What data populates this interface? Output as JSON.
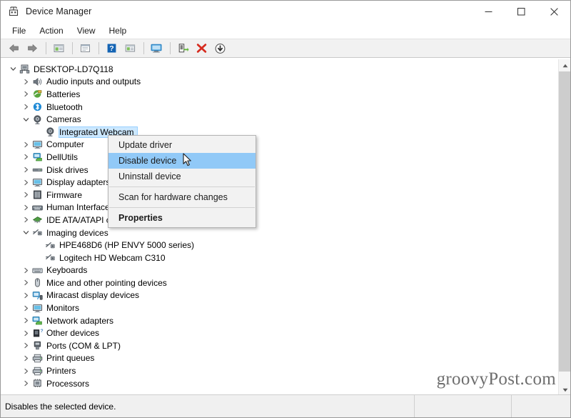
{
  "window": {
    "title": "Device Manager",
    "icon": "device-manager-icon",
    "controls": {
      "minimize": "—",
      "maximize": "☐",
      "close": "✕"
    }
  },
  "menubar": {
    "items": [
      {
        "label": "File"
      },
      {
        "label": "Action"
      },
      {
        "label": "View"
      },
      {
        "label": "Help"
      }
    ]
  },
  "toolbar": {
    "buttons": [
      {
        "name": "back-icon",
        "title": "Back"
      },
      {
        "name": "forward-icon",
        "title": "Forward"
      },
      {
        "name": "show-hide-console-tree-icon",
        "title": "Show/Hide Console Tree"
      },
      {
        "name": "properties-icon",
        "title": "Properties"
      },
      {
        "name": "help-icon",
        "title": "Help"
      },
      {
        "name": "update-driver-icon",
        "title": "Update driver"
      },
      {
        "name": "scan-hardware-changes-icon",
        "title": "Scan for hardware changes"
      },
      {
        "name": "enable-device-icon",
        "title": "Enable device"
      },
      {
        "name": "uninstall-device-icon",
        "title": "Uninstall device"
      },
      {
        "name": "disable-device-icon",
        "title": "Disable device"
      }
    ]
  },
  "tree": {
    "rows": [
      {
        "label": "DESKTOP-LD7Q118",
        "indent": 0,
        "expander": "expanded",
        "icon": "computer-icon",
        "selected": false
      },
      {
        "label": "Audio inputs and outputs",
        "indent": 1,
        "expander": "collapsed",
        "icon": "audio-icon",
        "selected": false
      },
      {
        "label": "Batteries",
        "indent": 1,
        "expander": "collapsed",
        "icon": "battery-icon",
        "selected": false
      },
      {
        "label": "Bluetooth",
        "indent": 1,
        "expander": "collapsed",
        "icon": "bluetooth-icon",
        "selected": false
      },
      {
        "label": "Cameras",
        "indent": 1,
        "expander": "expanded",
        "icon": "camera-icon",
        "selected": false
      },
      {
        "label": "Integrated Webcam",
        "indent": 2,
        "expander": "none",
        "icon": "camera-icon",
        "selected": true
      },
      {
        "label": "Computer",
        "indent": 1,
        "expander": "collapsed",
        "icon": "monitor-icon",
        "selected": false
      },
      {
        "label": "DellUtils",
        "indent": 1,
        "expander": "collapsed",
        "icon": "dellutils-icon",
        "selected": false
      },
      {
        "label": "Disk drives",
        "indent": 1,
        "expander": "collapsed",
        "icon": "disk-drive-icon",
        "selected": false
      },
      {
        "label": "Display adapters",
        "indent": 1,
        "expander": "collapsed",
        "icon": "display-adapter-icon",
        "selected": false
      },
      {
        "label": "Firmware",
        "indent": 1,
        "expander": "collapsed",
        "icon": "firmware-icon",
        "selected": false
      },
      {
        "label": "Human Interface Devices",
        "indent": 1,
        "expander": "collapsed",
        "icon": "hid-icon",
        "selected": false
      },
      {
        "label": "IDE ATA/ATAPI controllers",
        "indent": 1,
        "expander": "collapsed",
        "icon": "ide-controller-icon",
        "selected": false
      },
      {
        "label": "Imaging devices",
        "indent": 1,
        "expander": "expanded",
        "icon": "imaging-device-icon",
        "selected": false
      },
      {
        "label": "HPE468D6 (HP ENVY 5000 series)",
        "indent": 2,
        "expander": "none",
        "icon": "imaging-device-icon",
        "selected": false
      },
      {
        "label": "Logitech HD Webcam C310",
        "indent": 2,
        "expander": "none",
        "icon": "imaging-device-icon",
        "selected": false
      },
      {
        "label": "Keyboards",
        "indent": 1,
        "expander": "collapsed",
        "icon": "keyboard-icon",
        "selected": false
      },
      {
        "label": "Mice and other pointing devices",
        "indent": 1,
        "expander": "collapsed",
        "icon": "mouse-icon",
        "selected": false
      },
      {
        "label": "Miracast display devices",
        "indent": 1,
        "expander": "collapsed",
        "icon": "miracast-icon",
        "selected": false
      },
      {
        "label": "Monitors",
        "indent": 1,
        "expander": "collapsed",
        "icon": "monitor-icon",
        "selected": false
      },
      {
        "label": "Network adapters",
        "indent": 1,
        "expander": "collapsed",
        "icon": "network-adapter-icon",
        "selected": false
      },
      {
        "label": "Other devices",
        "indent": 1,
        "expander": "collapsed",
        "icon": "other-device-icon",
        "selected": false
      },
      {
        "label": "Ports (COM & LPT)",
        "indent": 1,
        "expander": "collapsed",
        "icon": "port-icon",
        "selected": false
      },
      {
        "label": "Print queues",
        "indent": 1,
        "expander": "collapsed",
        "icon": "printer-icon",
        "selected": false
      },
      {
        "label": "Printers",
        "indent": 1,
        "expander": "collapsed",
        "icon": "printer-icon",
        "selected": false
      },
      {
        "label": "Processors",
        "indent": 1,
        "expander": "collapsed",
        "icon": "processor-icon",
        "selected": false
      }
    ]
  },
  "context_menu": {
    "items": [
      {
        "label": "Update driver",
        "type": "item",
        "highlighted": false,
        "bold": false
      },
      {
        "label": "Disable device",
        "type": "item",
        "highlighted": true,
        "bold": false
      },
      {
        "label": "Uninstall device",
        "type": "item",
        "highlighted": false,
        "bold": false
      },
      {
        "label": "",
        "type": "separator",
        "highlighted": false,
        "bold": false
      },
      {
        "label": "Scan for hardware changes",
        "type": "item",
        "highlighted": false,
        "bold": false
      },
      {
        "label": "",
        "type": "separator",
        "highlighted": false,
        "bold": false
      },
      {
        "label": "Properties",
        "type": "item",
        "highlighted": false,
        "bold": true
      }
    ]
  },
  "statusbar": {
    "message": "Disables the selected device."
  },
  "watermark": {
    "text": "groovyPost.com"
  },
  "scrollbar": {
    "up_arrow": "▲",
    "down_arrow": "▼"
  },
  "colors": {
    "selection_blue": "#cce8ff",
    "menu_highlight_blue": "#91c9f7",
    "toolbar_bg": "#f1f1f1",
    "status_bg": "#f0f0f0"
  }
}
